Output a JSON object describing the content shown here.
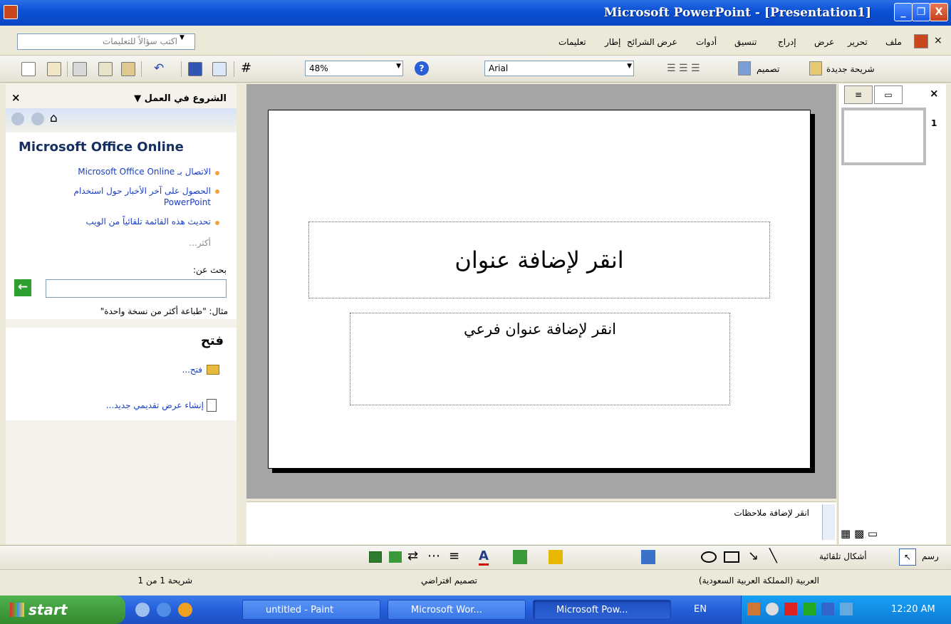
{
  "window": {
    "title": "Microsoft PowerPoint - [Presentation1]",
    "minimize_label": "_",
    "restore_label": "❐",
    "close_label": "X"
  },
  "menu": {
    "items": [
      "ملف",
      "تحرير",
      "عرض",
      "إدراج",
      "تنسيق",
      "أدوات",
      "عرض الشرائح",
      "إطار",
      "تعليمات"
    ],
    "close_label": "×"
  },
  "help_box": {
    "placeholder": "اكتب سؤالاً للتعليمات"
  },
  "toolbar": {
    "zoom": "48%",
    "font": "Arial",
    "new_slide_label": "شريحة جديدة",
    "design_label": "تصميم"
  },
  "task_pane": {
    "title": "الشروع في العمل",
    "close_label": "×",
    "office_online_heading": "Microsoft Office Online",
    "links": [
      "الاتصال بـ Microsoft Office Online",
      "الحصول على آخر الأخبار حول استخدام PowerPoint",
      "تحديث هذه القائمة تلقائياً من الويب"
    ],
    "more_label": "أكثر...",
    "search_label": "بحث عن:",
    "search_example": "مثال: \"طباعة أكثر من نسخة واحدة\"",
    "open_heading": "فتح",
    "open_link": "فتح...",
    "new_link": "إنشاء عرض تقديمي جديد..."
  },
  "slide": {
    "title_placeholder": "انقر لإضافة عنوان",
    "subtitle_placeholder": "انقر لإضافة عنوان فرعي"
  },
  "notes": {
    "placeholder": "انقر لإضافة ملاحظات"
  },
  "outline": {
    "slide_number": "1",
    "close_label": "×"
  },
  "drawing_toolbar": {
    "draw_label": "رسم",
    "autoshapes_label": "أشكال تلقائية"
  },
  "status_bar": {
    "slide_info": "شريحة 1 من 1",
    "design_name": "تصميم افتراضي",
    "language": "العربية (المملكة العربية السعودية)"
  },
  "taskbar": {
    "start_label": "start",
    "tasks": [
      "untitled - Paint",
      "Microsoft Wor...",
      "Microsoft Pow..."
    ],
    "language": "EN",
    "time": "12:20 AM"
  },
  "colors": {
    "title_bar": "#0a4fd4",
    "slide_area": "#a5a5a5",
    "link": "#1a3fc4",
    "taskbar": "#245edb"
  }
}
